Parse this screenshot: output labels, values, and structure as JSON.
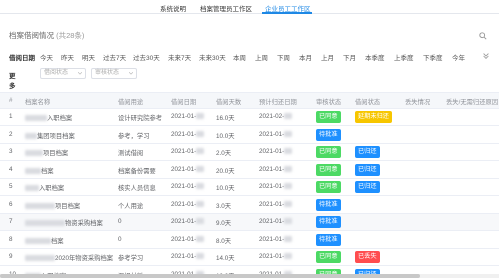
{
  "nav": {
    "tabs": [
      {
        "label": "系统说明"
      },
      {
        "label": "档案管理员工作区"
      },
      {
        "label": "企业员工工作区",
        "active": true
      }
    ]
  },
  "panel": {
    "title": "档案借阅情况",
    "count": "(共28条)"
  },
  "filters": {
    "date_label": "借阅日期",
    "date_options": [
      "今天",
      "昨天",
      "明天",
      "过去7天",
      "过去30天",
      "未来7天",
      "未来30天",
      "本周",
      "上周",
      "下周",
      "本月",
      "上月",
      "下月",
      "本季度",
      "上季度",
      "下季度",
      "今年"
    ],
    "more_label": "更多",
    "selects": [
      {
        "placeholder": "借阅状态"
      },
      {
        "placeholder": "审核状态"
      }
    ]
  },
  "table": {
    "columns": [
      "#",
      "档案名称",
      "借阅用途",
      "借阅日期",
      "借阅天数",
      "预计归还日期",
      "审核状态",
      "借阅状态",
      "丢失情况",
      "丢失/无需归还原因"
    ],
    "rows": [
      {
        "num": "1",
        "name": "入职档案",
        "purpose": "设计研究院参考",
        "date": "2021-01-",
        "days": "16.0天",
        "due": "2021-02-",
        "audit": "已同意",
        "audit_color": "green",
        "borrow": "延期未归还",
        "borrow_color": "yellow"
      },
      {
        "num": "2",
        "name": "集团项目档案",
        "purpose": "参考，学习",
        "date": "2021-01-",
        "days": "10.0天",
        "due": "2021-01-",
        "audit": "待批准",
        "audit_color": "blue",
        "borrow": "",
        "borrow_color": ""
      },
      {
        "num": "3",
        "name": "项目档案",
        "purpose": "测试借阅",
        "date": "2021-01-",
        "days": "2.0天",
        "due": "2021-01-",
        "audit": "已同意",
        "audit_color": "green",
        "borrow": "已归还",
        "borrow_color": "blue"
      },
      {
        "num": "4",
        "name": "档案",
        "purpose": "档案备份需要",
        "date": "2021-01-",
        "days": "20.0天",
        "due": "2021-01-",
        "audit": "已同意",
        "audit_color": "green",
        "borrow": "已归还",
        "borrow_color": "blue"
      },
      {
        "num": "5",
        "name": "入职档案",
        "purpose": "核实人员信息",
        "date": "2021-01-",
        "days": "10.0天",
        "due": "2021-01-",
        "audit": "已同意",
        "audit_color": "green",
        "borrow": "已归还",
        "borrow_color": "blue"
      },
      {
        "num": "6",
        "name": "项目档案",
        "purpose": "个人用途",
        "date": "2021-01-",
        "days": "3.0天",
        "due": "2021-01-",
        "audit": "待批准",
        "audit_color": "blue",
        "borrow": "",
        "borrow_color": ""
      },
      {
        "num": "7",
        "name": "物资采购档案",
        "purpose": "0",
        "date": "2021-01-",
        "days": "9.0天",
        "due": "2021-01-",
        "audit": "待批准",
        "audit_color": "blue",
        "borrow": "",
        "borrow_color": ""
      },
      {
        "num": "8",
        "name": "档案",
        "purpose": "0",
        "date": "2021-01-",
        "days": "8.0天",
        "due": "2021-01-",
        "audit": "待批准",
        "audit_color": "blue",
        "borrow": "",
        "borrow_color": ""
      },
      {
        "num": "9",
        "name": "2020年物资采购档案",
        "purpose": "参考学习",
        "date": "2021-01-",
        "days": "14.0天",
        "due": "2021-01-",
        "audit": "已同意",
        "audit_color": "green",
        "borrow": "已丢失",
        "borrow_color": "red"
      },
      {
        "num": "10",
        "name": "入职档案",
        "purpose": "汇报材料",
        "date": "2021-01-",
        "days": "10.0天",
        "due": "2021-01-",
        "audit": "已同意",
        "audit_color": "green",
        "borrow": "已归还",
        "borrow_color": "blue"
      }
    ]
  }
}
